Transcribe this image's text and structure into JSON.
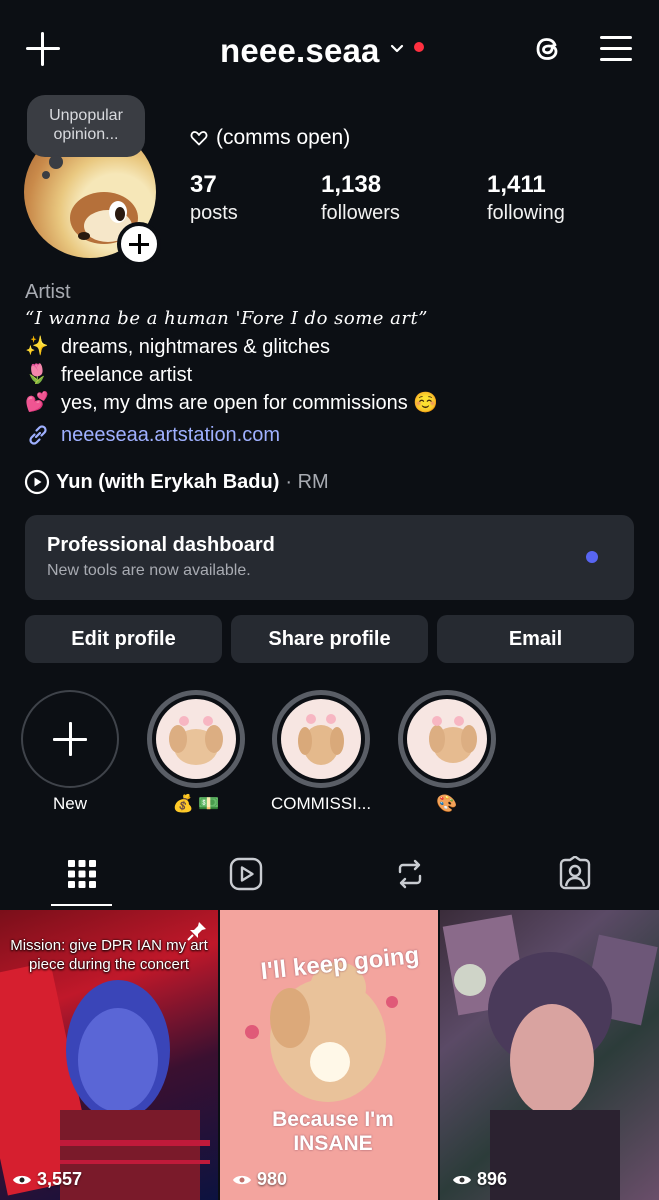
{
  "header": {
    "username": "neee.seaa",
    "icons": {
      "new_post": "plus-icon",
      "dropdown": "chevron-down-icon",
      "threads": "threads-icon",
      "menu": "hamburger-menu-icon"
    },
    "accent_color": "#ff3040"
  },
  "profile": {
    "note": "Unpopular opinion...",
    "pronoun_line": "(comms open)",
    "stats": [
      {
        "value": "37",
        "label": "posts"
      },
      {
        "value": "1,138",
        "label": "followers"
      },
      {
        "value": "1,411",
        "label": "following"
      }
    ]
  },
  "bio": {
    "category": "Artist",
    "quote": "“I wanna be a human 'Fore I do some art”",
    "lines": [
      {
        "emoji": "✨",
        "text": "dreams, nightmares & glitches"
      },
      {
        "emoji": "🌷",
        "text": "freelance artist"
      },
      {
        "emoji": "💕",
        "text": "yes, my dms are open for commissions ☺️"
      }
    ],
    "link": "neeeseaa.artstation.com",
    "link_color": "#9fb0ff"
  },
  "music": {
    "song": "Yun (with Erykah Badu)",
    "artist": "· RM"
  },
  "dashboard": {
    "title": "Professional dashboard",
    "subtitle": "New tools are now available.",
    "dot_color": "#5865f2"
  },
  "actions": {
    "edit": "Edit profile",
    "share": "Share profile",
    "email": "Email"
  },
  "highlights": [
    {
      "label": "New"
    },
    {
      "label": "💰 💵"
    },
    {
      "label": "COMMISSI..."
    },
    {
      "label": "🎨"
    }
  ],
  "tabs": [
    "grid-icon",
    "reels-icon",
    "reposts-icon",
    "tagged-icon"
  ],
  "posts": [
    {
      "caption": "Mission: give DPR IAN my art piece during the concert",
      "views": "3,557",
      "pinned": true
    },
    {
      "caption": "",
      "views": "980",
      "art_text_top": "I'll keep going",
      "art_text_bottom": "Because I'm INSANE"
    },
    {
      "caption": "",
      "views": "896"
    }
  ]
}
